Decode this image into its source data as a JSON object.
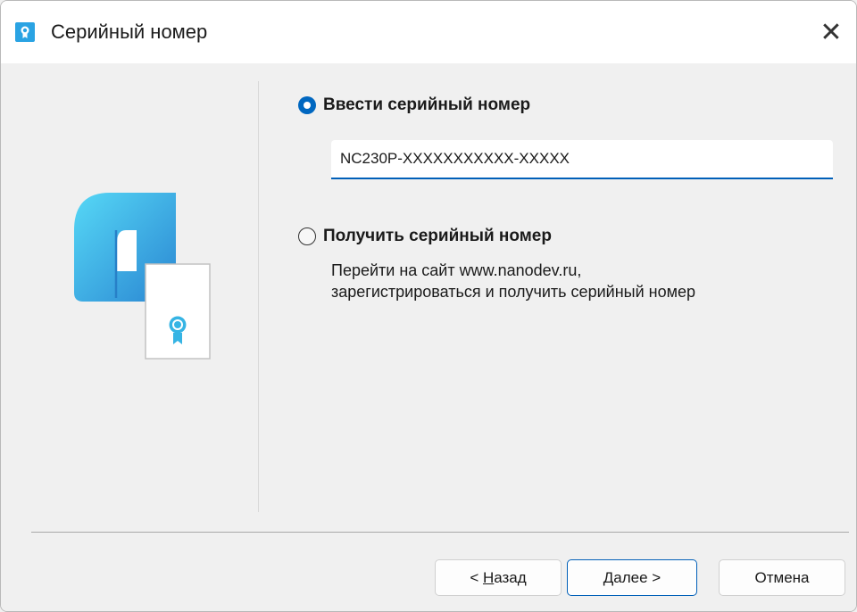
{
  "window": {
    "title": "Серийный номер",
    "icon": "certificate-app-icon",
    "close_symbol": "✕"
  },
  "options": {
    "enter": {
      "label": "Ввести серийный номер",
      "selected": true
    },
    "get": {
      "label": "Получить серийный номер",
      "selected": false
    }
  },
  "serial_input": {
    "value": "NC230P-XXXXXXXXXXX-XXXXX"
  },
  "description": {
    "line1": "Перейти на сайт www.nanodev.ru,",
    "line2": "зарегистрироваться и получить серийный номер"
  },
  "buttons": {
    "back": {
      "prefix": "< ",
      "access_key": "Н",
      "rest": "азад"
    },
    "next": {
      "access_key": "Д",
      "rest": "алее >"
    },
    "cancel": {
      "label": "Отмена"
    }
  },
  "colors": {
    "accent": "#0067c0",
    "logo_gradient_top": "#4fd2f4",
    "logo_gradient_bottom": "#2e8fd6",
    "cert_rosette": "#36b4e4"
  }
}
